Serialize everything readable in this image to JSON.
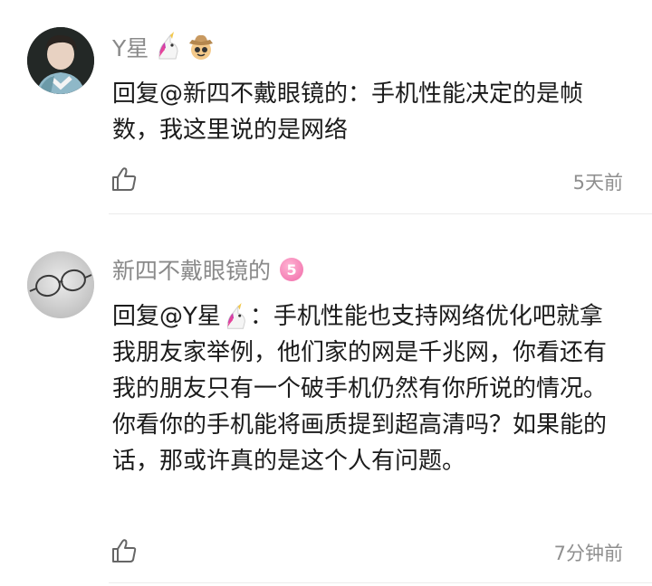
{
  "comments": [
    {
      "username": "Y星",
      "mention": "回复@新四不戴眼镜的",
      "text": "：手机性能决定的是帧数，我这里说的是网络",
      "time": "5天前"
    },
    {
      "username": "新四不戴眼镜的",
      "badge": "5",
      "mention_prefix": "回复@Y星",
      "text": "：手机性能也支持网络优化吧就拿我朋友家举例，他们家的网是千兆网，你看还有我的朋友只有一个破手机仍然有你所说的情况。你看你的手机能将画质提到超高清吗？如果能的话，那或许真的是这个人有问题。",
      "time": "7分钟前"
    }
  ],
  "icons": {
    "like": "thumbs-up-icon",
    "unicorn": "unicorn-emoji-icon",
    "cowboy": "cowboy-emoji-icon"
  },
  "colors": {
    "username": "#8a8a8a",
    "text": "#1b1b1b",
    "time": "#8f8f8f",
    "badge": "#f06aa8"
  }
}
